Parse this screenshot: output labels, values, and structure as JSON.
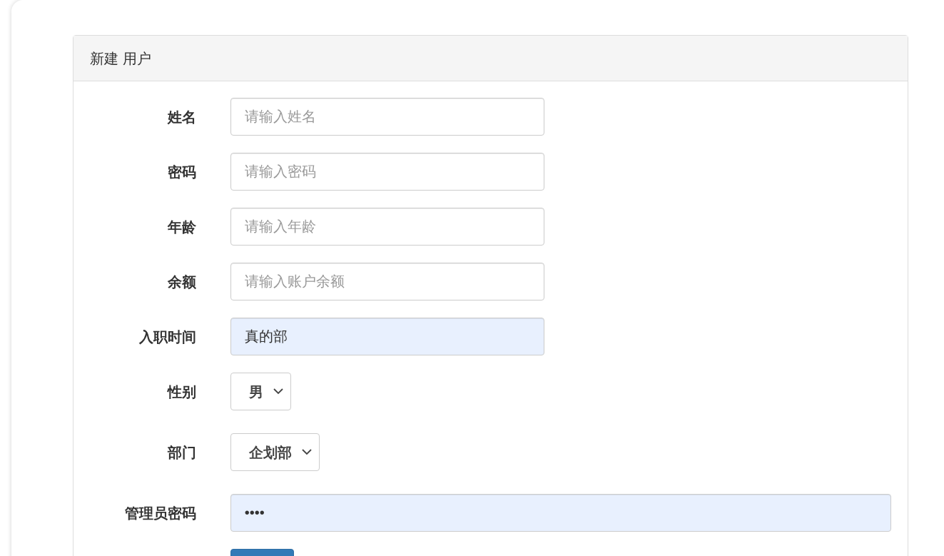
{
  "card": {
    "title": "新建 用户"
  },
  "fields": [
    {
      "label": "姓名",
      "kind": "text",
      "placeholder": "请输入姓名",
      "autofilled": false
    },
    {
      "label": "密码",
      "kind": "text",
      "placeholder": "请输入密码",
      "autofilled": false
    },
    {
      "label": "年龄",
      "kind": "text",
      "placeholder": "请输入年龄",
      "autofilled": false
    },
    {
      "label": "余额",
      "kind": "text",
      "placeholder": "请输入账户余额",
      "autofilled": false
    },
    {
      "label": "入职时间",
      "kind": "text",
      "value": "真的部",
      "autofilled": true
    },
    {
      "label": "性别",
      "kind": "select",
      "value": "男"
    },
    {
      "label": "部门",
      "kind": "select",
      "value": "企划部"
    },
    {
      "label": "管理员密码",
      "kind": "wide",
      "value": "••••",
      "autofilled": true
    }
  ]
}
